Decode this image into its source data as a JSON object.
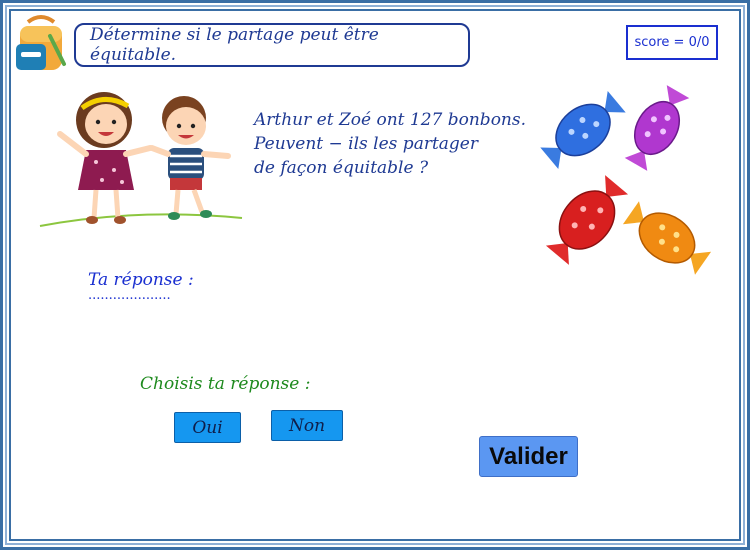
{
  "header": {
    "instruction": "Détermine si le partage peut être équitable.",
    "score": "score = 0/0"
  },
  "problem": {
    "line1": "Arthur et Zoé ont 127 bonbons.",
    "line2": "Peuvent − ils les partager",
    "line3": "de façon équitable ?"
  },
  "answer": {
    "label": "Ta réponse :",
    "placeholder": "...................."
  },
  "choices": {
    "label": "Choisis ta réponse :",
    "oui": "Oui",
    "non": "Non"
  },
  "actions": {
    "validate": "Valider"
  },
  "icons": {
    "backpack": "backpack-icon",
    "kids": "children-holding-hands-illustration",
    "candies": "candies-illustration"
  },
  "colors": {
    "frame": "#3a6ea5",
    "text_blue": "#1f3a93",
    "green_label": "#1e8a1e",
    "choice_button": "#1597f0",
    "validate_button": "#5b97f2"
  }
}
